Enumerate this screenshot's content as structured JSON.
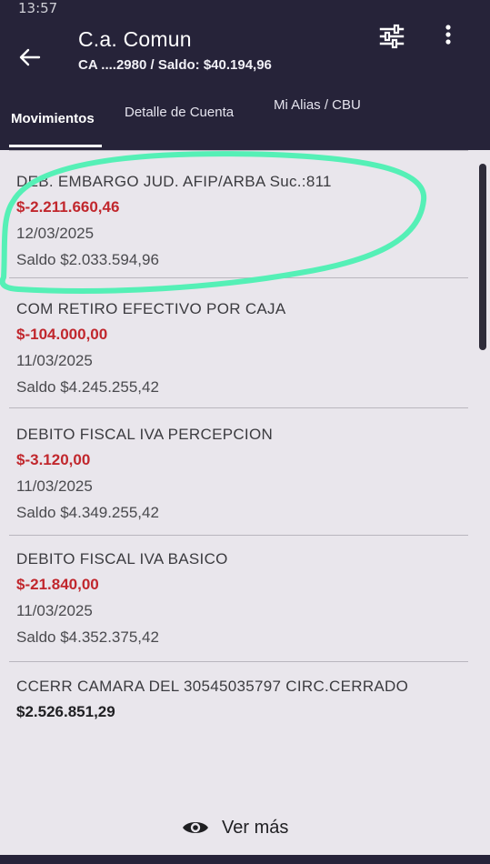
{
  "status_bar": {
    "time": "13:57"
  },
  "header": {
    "title": "C.a. Comun",
    "subtitle": "CA ....2980 / Saldo: $40.194,96",
    "back_icon": "arrow-left-icon",
    "filter_icon": "sliders-icon",
    "more_icon": "more-vertical-icon"
  },
  "tabs": [
    {
      "label": "Movimientos",
      "active": true
    },
    {
      "label": "Detalle de Cuenta",
      "active": false
    },
    {
      "label": "Mi Alias / CBU",
      "active": false
    }
  ],
  "colors": {
    "header_bg": "#262339",
    "debit": "#c1272d",
    "highlight": "#55f0b6",
    "list_bg": "#e9e6ec"
  },
  "movements": [
    {
      "description": "DEB. EMBARGO JUD. AFIP/ARBA Suc.:811",
      "amount": "$-2.211.660,46",
      "date": "12/03/2025",
      "saldo": "Saldo $2.033.594,96",
      "highlighted": true
    },
    {
      "description": "COM RETIRO EFECTIVO POR CAJA",
      "amount": "$-104.000,00",
      "date": "11/03/2025",
      "saldo": "Saldo $4.245.255,42"
    },
    {
      "description": "DEBITO FISCAL IVA PERCEPCION",
      "amount": "$-3.120,00",
      "date": "11/03/2025",
      "saldo": "Saldo $4.349.255,42"
    },
    {
      "description": "DEBITO FISCAL IVA BASICO",
      "amount": "$-21.840,00",
      "date": "11/03/2025",
      "saldo": "Saldo $4.352.375,42"
    },
    {
      "description": "CCERR CAMARA DEL  30545035797 CIRC.CERRADO",
      "amount": "$2.526.851,29"
    }
  ],
  "ver_mas": {
    "label": "Ver más",
    "icon": "eye-icon"
  }
}
